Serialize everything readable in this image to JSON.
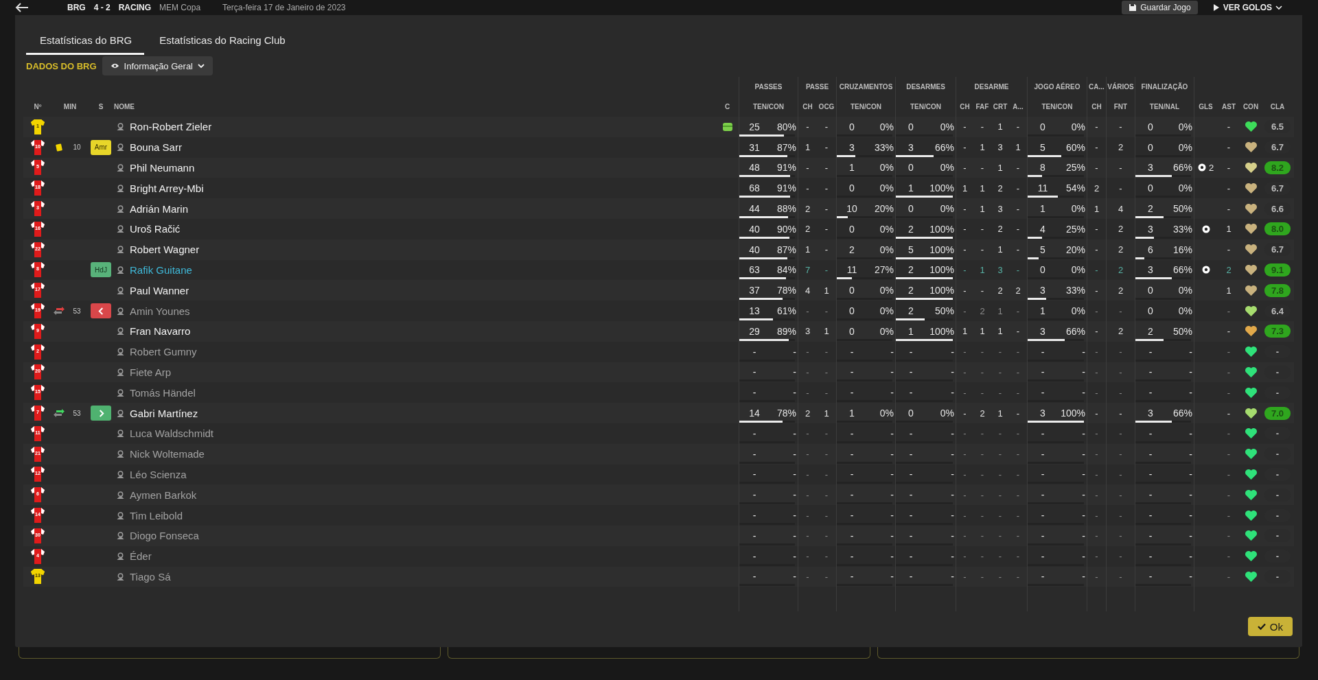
{
  "top_bar": {
    "home": "BRG",
    "score": "4 - 2",
    "away": "RACING",
    "competition": "MEM Copa",
    "date": "Terça-feira 17 de Janeiro de 2023",
    "save_button": "Guardar Jogo",
    "goals_button": "VER GOLOS"
  },
  "tabs": [
    {
      "label": "Estatísticas do BRG",
      "selected": true
    },
    {
      "label": "Estatísticas do Racing Club",
      "selected": false
    }
  ],
  "section_label": "DADOS DO BRG",
  "view_dropdown": "Informação Geral",
  "left_headers": [
    "Nº",
    "MIN",
    "S",
    "NOME",
    "C"
  ],
  "groups": [
    {
      "label": "PASSES",
      "columns": [
        "TEN/CON"
      ]
    },
    {
      "label": "PASSE",
      "columns": [
        "CH",
        "OCG"
      ]
    },
    {
      "label": "CRUZAMENTOS",
      "columns": [
        "TEN/CON"
      ]
    },
    {
      "label": "DESARMES",
      "columns": [
        "TEN/CON"
      ]
    },
    {
      "label": "DESARME",
      "columns": [
        "CH",
        "FAF",
        "CRT",
        "A..."
      ]
    },
    {
      "label": "JOGO AÉREO",
      "columns": [
        "TEN/CON"
      ]
    },
    {
      "label": "CA...",
      "columns": [
        "CH"
      ]
    },
    {
      "label": "VÁRIOS",
      "columns": [
        "FNT"
      ]
    },
    {
      "label": "FINALIZAÇÃO",
      "columns": [
        "TEN/NAL"
      ]
    }
  ],
  "right_headers": [
    "GLS",
    "AST",
    "CON",
    "CLA"
  ],
  "rows": [
    {
      "num": "1",
      "goalkeeper": true,
      "name": "Ron-Robert Zieler",
      "kind": "played",
      "captain": true,
      "passes": {
        "ten": "25",
        "con": "80%",
        "level": 0.8
      },
      "passe": [
        "-",
        "-"
      ],
      "crosses": {
        "ten": "0",
        "con": "0%"
      },
      "tackles": {
        "ten": "0",
        "con": "0%"
      },
      "desarme": [
        "-",
        "-",
        "1",
        "-"
      ],
      "aerial": {
        "ten": "0",
        "con": "0%"
      },
      "ca": "-",
      "fnt": "-",
      "shots": {
        "ten": "0",
        "con": "0%"
      },
      "goal": false,
      "ast": "-",
      "color": "#3ddc5a",
      "rating": "6.5",
      "rating_high": false
    },
    {
      "num": "10",
      "goalkeeper": false,
      "event": {
        "kind": "yellow_card",
        "minute": "10"
      },
      "badge": {
        "kind": "amr",
        "label": "Amr"
      },
      "name": "Bouna Sarr",
      "kind": "played",
      "captain": false,
      "passes": {
        "ten": "31",
        "con": "87%",
        "level": 0.87
      },
      "passe": [
        "1",
        "-"
      ],
      "crosses": {
        "ten": "3",
        "con": "33%",
        "level": 0.33
      },
      "tackles": {
        "ten": "3",
        "con": "66%",
        "level": 0.66
      },
      "desarme": [
        "-",
        "1",
        "3",
        "1"
      ],
      "aerial": {
        "ten": "5",
        "con": "60%",
        "level": 0.6
      },
      "ca": "-",
      "fnt": "2",
      "shots": {
        "ten": "0",
        "con": "0%"
      },
      "goal": false,
      "ast": "-",
      "color": "#c9b27e",
      "rating": "6.7",
      "rating_high": false
    },
    {
      "num": "5",
      "goalkeeper": false,
      "name": "Phil Neumann",
      "kind": "played",
      "captain": false,
      "passes": {
        "ten": "48",
        "con": "91%",
        "level": 0.91
      },
      "passe": [
        "-",
        "-"
      ],
      "crosses": {
        "ten": "1",
        "con": "0%"
      },
      "tackles": {
        "ten": "0",
        "con": "0%"
      },
      "desarme": [
        "-",
        "-",
        "1",
        "-"
      ],
      "aerial": {
        "ten": "8",
        "con": "25%",
        "level": 0.25
      },
      "ca": "-",
      "fnt": "-",
      "shots": {
        "ten": "3",
        "con": "66%",
        "level": 0.66
      },
      "goal": true,
      "goal_count": "2",
      "ast": "-",
      "color": "#d6cf8a",
      "rating": "8.2",
      "rating_high": true
    },
    {
      "num": "18",
      "goalkeeper": false,
      "name": "Bright Arrey-Mbi",
      "kind": "played",
      "captain": false,
      "passes": {
        "ten": "68",
        "con": "91%",
        "level": 0.91
      },
      "passe": [
        "-",
        "-"
      ],
      "crosses": {
        "ten": "0",
        "con": "0%"
      },
      "tackles": {
        "ten": "1",
        "con": "100%",
        "level": 1
      },
      "desarme": [
        "1",
        "1",
        "2",
        "-"
      ],
      "aerial": {
        "ten": "11",
        "con": "54%",
        "level": 0.54
      },
      "ca": "2",
      "fnt": "-",
      "shots": {
        "ten": "0",
        "con": "0%"
      },
      "goal": false,
      "ast": "-",
      "color": "#c9b27e",
      "rating": "6.7",
      "rating_high": false
    },
    {
      "num": "3",
      "goalkeeper": false,
      "name": "Adrián Marin",
      "kind": "played",
      "captain": false,
      "passes": {
        "ten": "44",
        "con": "88%",
        "level": 0.88
      },
      "passe": [
        "2",
        "-"
      ],
      "crosses": {
        "ten": "10",
        "con": "20%",
        "level": 0.2
      },
      "tackles": {
        "ten": "0",
        "con": "0%"
      },
      "desarme": [
        "-",
        "1",
        "3",
        "-"
      ],
      "aerial": {
        "ten": "1",
        "con": "0%"
      },
      "ca": "1",
      "fnt": "4",
      "shots": {
        "ten": "2",
        "con": "50%",
        "level": 0.5
      },
      "goal": false,
      "ast": "-",
      "color": "#c9b27e",
      "rating": "6.6",
      "rating_high": false
    },
    {
      "num": "16",
      "goalkeeper": false,
      "name": "Uroš Račić",
      "kind": "played",
      "captain": false,
      "passes": {
        "ten": "40",
        "con": "90%",
        "level": 0.9
      },
      "passe": [
        "2",
        "-"
      ],
      "crosses": {
        "ten": "0",
        "con": "0%"
      },
      "tackles": {
        "ten": "2",
        "con": "100%",
        "level": 1
      },
      "desarme": [
        "-",
        "-",
        "2",
        "-"
      ],
      "aerial": {
        "ten": "4",
        "con": "25%",
        "level": 0.25
      },
      "ca": "-",
      "fnt": "2",
      "shots": {
        "ten": "3",
        "con": "33%",
        "level": 0.33
      },
      "goal": true,
      "ast": "1",
      "color": "#c9b27e",
      "rating": "8.0",
      "rating_high": true
    },
    {
      "num": "22",
      "goalkeeper": false,
      "name": "Robert Wagner",
      "kind": "played",
      "captain": false,
      "passes": {
        "ten": "40",
        "con": "87%",
        "level": 0.87
      },
      "passe": [
        "1",
        "-"
      ],
      "crosses": {
        "ten": "2",
        "con": "0%"
      },
      "tackles": {
        "ten": "5",
        "con": "100%",
        "level": 1
      },
      "desarme": [
        "-",
        "-",
        "1",
        "-"
      ],
      "aerial": {
        "ten": "5",
        "con": "20%",
        "level": 0.2
      },
      "ca": "-",
      "fnt": "2",
      "shots": {
        "ten": "6",
        "con": "16%",
        "level": 0.16
      },
      "goal": false,
      "ast": "-",
      "color": "#c9b27e",
      "rating": "6.7",
      "rating_high": false
    },
    {
      "num": "8",
      "goalkeeper": false,
      "badge": {
        "kind": "hdj",
        "label": "HdJ"
      },
      "name": "Rafik Guitane",
      "kind": "potm",
      "captain": false,
      "passes": {
        "ten": "63",
        "con": "84%",
        "level": 0.84
      },
      "passe": [
        "7",
        "-"
      ],
      "crosses": {
        "ten": "11",
        "con": "27%",
        "level": 0.27
      },
      "tackles": {
        "ten": "2",
        "con": "100%",
        "level": 1
      },
      "desarme": [
        "-",
        "1",
        "3",
        "-"
      ],
      "aerial": {
        "ten": "0",
        "con": "0%"
      },
      "ca": "-",
      "fnt": "2",
      "shots": {
        "ten": "3",
        "con": "66%",
        "level": 0.66
      },
      "goal": true,
      "ast": "2",
      "color": "#c9b27e",
      "rating": "9.1",
      "rating_high": true
    },
    {
      "num": "17",
      "goalkeeper": false,
      "name": "Paul Wanner",
      "kind": "played",
      "captain": false,
      "passes": {
        "ten": "37",
        "con": "78%",
        "level": 0.78
      },
      "passe": [
        "4",
        "1"
      ],
      "crosses": {
        "ten": "0",
        "con": "0%"
      },
      "tackles": {
        "ten": "2",
        "con": "100%",
        "level": 1
      },
      "desarme": [
        "-",
        "-",
        "2",
        "2"
      ],
      "aerial": {
        "ten": "3",
        "con": "33%",
        "level": 0.33
      },
      "ca": "-",
      "fnt": "2",
      "shots": {
        "ten": "0",
        "con": "0%"
      },
      "goal": false,
      "ast": "1",
      "color": "#c9b27e",
      "rating": "7.8",
      "rating_high": true
    },
    {
      "num": "19",
      "goalkeeper": false,
      "event": {
        "kind": "sub_out",
        "minute": "53"
      },
      "badge": {
        "kind": "out"
      },
      "name": "Amin Younes",
      "kind": "subbed_off",
      "captain": false,
      "passes": {
        "ten": "13",
        "con": "61%",
        "level": 0.61
      },
      "passe": [
        "-",
        "-"
      ],
      "crosses": {
        "ten": "0",
        "con": "0%"
      },
      "tackles": {
        "ten": "2",
        "con": "50%",
        "level": 0.5
      },
      "desarme": [
        "-",
        "2",
        "1",
        "-"
      ],
      "aerial": {
        "ten": "1",
        "con": "0%"
      },
      "ca": "-",
      "fnt": "-",
      "shots": {
        "ten": "0",
        "con": "0%"
      },
      "goal": false,
      "ast": "-",
      "color": "#a6dc6e",
      "rating": "6.4",
      "rating_high": false
    },
    {
      "num": "9",
      "goalkeeper": false,
      "name": "Fran Navarro",
      "kind": "played",
      "captain": false,
      "passes": {
        "ten": "29",
        "con": "89%",
        "level": 0.89
      },
      "passe": [
        "3",
        "1"
      ],
      "crosses": {
        "ten": "0",
        "con": "0%"
      },
      "tackles": {
        "ten": "1",
        "con": "100%",
        "level": 1
      },
      "desarme": [
        "1",
        "1",
        "1",
        "-"
      ],
      "aerial": {
        "ten": "3",
        "con": "66%",
        "level": 0.66
      },
      "ca": "-",
      "fnt": "2",
      "shots": {
        "ten": "2",
        "con": "50%",
        "level": 0.5
      },
      "goal": false,
      "ast": "-",
      "color": "#e2a94a",
      "rating": "7.3",
      "rating_high": true
    },
    {
      "num": "2",
      "goalkeeper": false,
      "name": "Robert Gumny",
      "kind": "unused",
      "captain": false,
      "passes": {
        "ten": "-",
        "con": "-"
      },
      "passe": [
        "-",
        "-"
      ],
      "crosses": {
        "ten": "-",
        "con": "-"
      },
      "tackles": {
        "ten": "-",
        "con": "-"
      },
      "desarme": [
        "-",
        "-",
        "-",
        "-"
      ],
      "aerial": {
        "ten": "-",
        "con": "-"
      },
      "ca": "-",
      "fnt": "-",
      "shots": {
        "ten": "-",
        "con": "-"
      },
      "goal": false,
      "ast": "-",
      "color": "#2fe27a",
      "rating": "-",
      "rating_high": false
    },
    {
      "num": "20",
      "goalkeeper": false,
      "name": "Fiete Arp",
      "kind": "unused",
      "captain": false,
      "passes": {
        "ten": "-",
        "con": "-"
      },
      "passe": [
        "-",
        "-"
      ],
      "crosses": {
        "ten": "-",
        "con": "-"
      },
      "tackles": {
        "ten": "-",
        "con": "-"
      },
      "desarme": [
        "-",
        "-",
        "-",
        "-"
      ],
      "aerial": {
        "ten": "-",
        "con": "-"
      },
      "ca": "-",
      "fnt": "-",
      "shots": {
        "ten": "-",
        "con": "-"
      },
      "goal": false,
      "ast": "-",
      "color": "#2fe27a",
      "rating": "-",
      "rating_high": false
    },
    {
      "num": "15",
      "goalkeeper": false,
      "name": "Tomás Händel",
      "kind": "unused",
      "captain": false,
      "passes": {
        "ten": "-",
        "con": "-"
      },
      "passe": [
        "-",
        "-"
      ],
      "crosses": {
        "ten": "-",
        "con": "-"
      },
      "tackles": {
        "ten": "-",
        "con": "-"
      },
      "desarme": [
        "-",
        "-",
        "-",
        "-"
      ],
      "aerial": {
        "ten": "-",
        "con": "-"
      },
      "ca": "-",
      "fnt": "-",
      "shots": {
        "ten": "-",
        "con": "-"
      },
      "goal": false,
      "ast": "-",
      "color": "#2fe27a",
      "rating": "-",
      "rating_high": false
    },
    {
      "num": "7",
      "goalkeeper": false,
      "event": {
        "kind": "sub_in",
        "minute": "53"
      },
      "badge": {
        "kind": "in"
      },
      "name": "Gabri Martínez",
      "kind": "played",
      "captain": false,
      "passes": {
        "ten": "14",
        "con": "78%",
        "level": 0.78
      },
      "passe": [
        "2",
        "1"
      ],
      "crosses": {
        "ten": "1",
        "con": "0%"
      },
      "tackles": {
        "ten": "0",
        "con": "0%"
      },
      "desarme": [
        "-",
        "2",
        "1",
        "-"
      ],
      "aerial": {
        "ten": "3",
        "con": "100%",
        "level": 1
      },
      "ca": "-",
      "fnt": "-",
      "shots": {
        "ten": "3",
        "con": "66%",
        "level": 0.66
      },
      "goal": false,
      "ast": "-",
      "color": "#a6dc6e",
      "rating": "7.0",
      "rating_high": true
    },
    {
      "num": "11",
      "goalkeeper": false,
      "name": "Luca Waldschmidt",
      "kind": "unused",
      "captain": false,
      "passes": {
        "ten": "-",
        "con": "-"
      },
      "passe": [
        "-",
        "-"
      ],
      "crosses": {
        "ten": "-",
        "con": "-"
      },
      "tackles": {
        "ten": "-",
        "con": "-"
      },
      "desarme": [
        "-",
        "-",
        "-",
        "-"
      ],
      "aerial": {
        "ten": "-",
        "con": "-"
      },
      "ca": "-",
      "fnt": "-",
      "shots": {
        "ten": "-",
        "con": "-"
      },
      "goal": false,
      "ast": "-",
      "color": "#2fe27a",
      "rating": "-",
      "rating_high": false
    },
    {
      "num": "21",
      "goalkeeper": false,
      "name": "Nick Woltemade",
      "kind": "unused",
      "captain": false,
      "passes": {
        "ten": "-",
        "con": "-"
      },
      "passe": [
        "-",
        "-"
      ],
      "crosses": {
        "ten": "-",
        "con": "-"
      },
      "tackles": {
        "ten": "-",
        "con": "-"
      },
      "desarme": [
        "-",
        "-",
        "-",
        "-"
      ],
      "aerial": {
        "ten": "-",
        "con": "-"
      },
      "ca": "-",
      "fnt": "-",
      "shots": {
        "ten": "-",
        "con": "-"
      },
      "goal": false,
      "ast": "-",
      "color": "#2fe27a",
      "rating": "-",
      "rating_high": false
    },
    {
      "num": "12",
      "goalkeeper": false,
      "name": "Léo Scienza",
      "kind": "unused",
      "captain": false,
      "passes": {
        "ten": "-",
        "con": "-"
      },
      "passe": [
        "-",
        "-"
      ],
      "crosses": {
        "ten": "-",
        "con": "-"
      },
      "tackles": {
        "ten": "-",
        "con": "-"
      },
      "desarme": [
        "-",
        "-",
        "-",
        "-"
      ],
      "aerial": {
        "ten": "-",
        "con": "-"
      },
      "ca": "-",
      "fnt": "-",
      "shots": {
        "ten": "-",
        "con": "-"
      },
      "goal": false,
      "ast": "-",
      "color": "#2fe27a",
      "rating": "-",
      "rating_high": false
    },
    {
      "num": "6",
      "goalkeeper": false,
      "name": "Aymen Barkok",
      "kind": "unused",
      "captain": false,
      "passes": {
        "ten": "-",
        "con": "-"
      },
      "passe": [
        "-",
        "-"
      ],
      "crosses": {
        "ten": "-",
        "con": "-"
      },
      "tackles": {
        "ten": "-",
        "con": "-"
      },
      "desarme": [
        "-",
        "-",
        "-",
        "-"
      ],
      "aerial": {
        "ten": "-",
        "con": "-"
      },
      "ca": "-",
      "fnt": "-",
      "shots": {
        "ten": "-",
        "con": "-"
      },
      "goal": false,
      "ast": "-",
      "color": "#2fe27a",
      "rating": "-",
      "rating_high": false
    },
    {
      "num": "14",
      "goalkeeper": false,
      "name": "Tim Leibold",
      "kind": "unused",
      "captain": false,
      "passes": {
        "ten": "-",
        "con": "-"
      },
      "passe": [
        "-",
        "-"
      ],
      "crosses": {
        "ten": "-",
        "con": "-"
      },
      "tackles": {
        "ten": "-",
        "con": "-"
      },
      "desarme": [
        "-",
        "-",
        "-",
        "-"
      ],
      "aerial": {
        "ten": "-",
        "con": "-"
      },
      "ca": "-",
      "fnt": "-",
      "shots": {
        "ten": "-",
        "con": "-"
      },
      "goal": false,
      "ast": "-",
      "color": "#2fe27a",
      "rating": "-",
      "rating_high": false
    },
    {
      "num": "30",
      "goalkeeper": false,
      "name": "Diogo Fonseca",
      "kind": "unused",
      "captain": false,
      "passes": {
        "ten": "-",
        "con": "-"
      },
      "passe": [
        "-",
        "-"
      ],
      "crosses": {
        "ten": "-",
        "con": "-"
      },
      "tackles": {
        "ten": "-",
        "con": "-"
      },
      "desarme": [
        "-",
        "-",
        "-",
        "-"
      ],
      "aerial": {
        "ten": "-",
        "con": "-"
      },
      "ca": "-",
      "fnt": "-",
      "shots": {
        "ten": "-",
        "con": "-"
      },
      "goal": false,
      "ast": "-",
      "color": "#2fe27a",
      "rating": "-",
      "rating_high": false
    },
    {
      "num": "4",
      "goalkeeper": false,
      "name": "Éder",
      "kind": "unused",
      "captain": false,
      "passes": {
        "ten": "-",
        "con": "-"
      },
      "passe": [
        "-",
        "-"
      ],
      "crosses": {
        "ten": "-",
        "con": "-"
      },
      "tackles": {
        "ten": "-",
        "con": "-"
      },
      "desarme": [
        "-",
        "-",
        "-",
        "-"
      ],
      "aerial": {
        "ten": "-",
        "con": "-"
      },
      "ca": "-",
      "fnt": "-",
      "shots": {
        "ten": "-",
        "con": "-"
      },
      "goal": false,
      "ast": "-",
      "color": "#2fe27a",
      "rating": "-",
      "rating_high": false
    },
    {
      "num": "13",
      "goalkeeper": true,
      "name": "Tiago Sá",
      "kind": "unused",
      "captain": false,
      "passes": {
        "ten": "-",
        "con": "-"
      },
      "passe": [
        "-",
        "-"
      ],
      "crosses": {
        "ten": "-",
        "con": "-"
      },
      "tackles": {
        "ten": "-",
        "con": "-"
      },
      "desarme": [
        "-",
        "-",
        "-",
        "-"
      ],
      "aerial": {
        "ten": "-",
        "con": "-"
      },
      "ca": "-",
      "fnt": "-",
      "shots": {
        "ten": "-",
        "con": "-"
      },
      "goal": false,
      "ast": "-",
      "color": "#2fe27a",
      "rating": "-",
      "rating_high": false
    }
  ],
  "ok_button": "Ok"
}
